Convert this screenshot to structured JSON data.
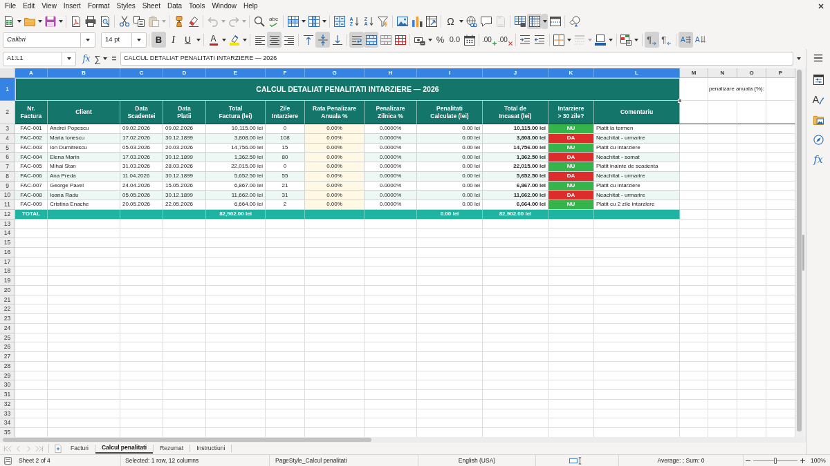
{
  "menu_bar": {
    "items": [
      "File",
      "Edit",
      "View",
      "Insert",
      "Format",
      "Styles",
      "Sheet",
      "Data",
      "Tools",
      "Window",
      "Help"
    ]
  },
  "standard_toolbar": [
    [
      {
        "kind": "new_document",
        "dropdown": true,
        "pressed": false,
        "disabled": false
      },
      {
        "kind": "open",
        "dropdown": true,
        "pressed": false,
        "disabled": false
      },
      {
        "kind": "save",
        "dropdown": true,
        "pressed": false,
        "disabled": false
      }
    ],
    [
      {
        "kind": "export_pdf",
        "dropdown": false,
        "pressed": false,
        "disabled": false
      },
      {
        "kind": "print",
        "dropdown": false,
        "pressed": false,
        "disabled": false
      },
      {
        "kind": "print_preview",
        "dropdown": false,
        "pressed": false,
        "disabled": false
      }
    ],
    [
      {
        "kind": "cut",
        "dropdown": false,
        "pressed": false,
        "disabled": false
      },
      {
        "kind": "copy",
        "dropdown": false,
        "pressed": false,
        "disabled": false
      },
      {
        "kind": "paste",
        "dropdown": true,
        "pressed": false,
        "disabled": true
      }
    ],
    [
      {
        "kind": "clone_formatting",
        "dropdown": false,
        "pressed": false,
        "disabled": false
      },
      {
        "kind": "clear_formatting",
        "dropdown": false,
        "pressed": false,
        "disabled": false
      }
    ],
    [
      {
        "kind": "undo",
        "dropdown": true,
        "pressed": false,
        "disabled": true
      },
      {
        "kind": "redo",
        "dropdown": true,
        "pressed": false,
        "disabled": true
      }
    ],
    [
      {
        "kind": "find_replace",
        "dropdown": false,
        "pressed": false,
        "disabled": false
      },
      {
        "kind": "spelling",
        "glyph": "abc",
        "dropdown": false,
        "pressed": false,
        "disabled": false
      }
    ],
    [
      {
        "kind": "row",
        "dropdown": true,
        "pressed": false,
        "disabled": false
      },
      {
        "kind": "column",
        "dropdown": true,
        "pressed": false,
        "disabled": false
      }
    ],
    [
      {
        "kind": "sort",
        "dropdown": false,
        "pressed": false,
        "disabled": false
      },
      {
        "kind": "sort_ascending",
        "glyph": "AZ",
        "dropdown": false,
        "pressed": false,
        "disabled": false
      },
      {
        "kind": "sort_descending",
        "glyph": "ZA",
        "dropdown": false,
        "pressed": false,
        "disabled": false
      },
      {
        "kind": "autofilter",
        "dropdown": false,
        "pressed": false,
        "disabled": false
      }
    ],
    [
      {
        "kind": "image",
        "dropdown": false,
        "pressed": false,
        "disabled": false
      },
      {
        "kind": "chart",
        "dropdown": false,
        "pressed": false,
        "disabled": false
      },
      {
        "kind": "pivot_table",
        "dropdown": false,
        "pressed": false,
        "disabled": false
      }
    ],
    [
      {
        "kind": "special_character",
        "glyph": "Ω",
        "dropdown": true,
        "pressed": false,
        "disabled": false
      },
      {
        "kind": "hyperlink",
        "dropdown": false,
        "pressed": false,
        "disabled": false
      },
      {
        "kind": "comment",
        "dropdown": false,
        "pressed": false,
        "disabled": false
      },
      {
        "kind": "header_footer",
        "dropdown": false,
        "pressed": false,
        "disabled": true
      }
    ],
    [
      {
        "kind": "print_area",
        "dropdown": false,
        "pressed": false,
        "disabled": false
      },
      {
        "kind": "freeze",
        "dropdown": true,
        "pressed": true,
        "disabled": false
      },
      {
        "kind": "split_window",
        "dropdown": false,
        "pressed": false,
        "disabled": false
      }
    ],
    [
      {
        "kind": "draw_functions",
        "dropdown": false,
        "pressed": false,
        "disabled": false
      }
    ]
  ],
  "formatting_toolbar": {
    "font_name": "Calibri",
    "font_size": "14 pt",
    "groups": [
      [
        {
          "kind": "bold",
          "glyph": "B",
          "dropdown": false,
          "pressed": true,
          "disabled": false
        },
        {
          "kind": "italic",
          "glyph": "I",
          "dropdown": false,
          "pressed": false,
          "disabled": false
        },
        {
          "kind": "underline",
          "glyph": "U",
          "dropdown": true,
          "pressed": false,
          "disabled": false
        }
      ],
      [
        {
          "kind": "font_color",
          "glyph": "A",
          "dropdown": true,
          "pressed": false,
          "disabled": false
        },
        {
          "kind": "highlight",
          "dropdown": true,
          "pressed": false,
          "disabled": false
        }
      ],
      [
        {
          "kind": "align_left",
          "dropdown": false,
          "pressed": false,
          "disabled": false
        },
        {
          "kind": "align_center",
          "dropdown": false,
          "pressed": true,
          "disabled": false
        },
        {
          "kind": "align_right",
          "dropdown": false,
          "pressed": false,
          "disabled": false
        }
      ],
      [
        {
          "kind": "align_top",
          "dropdown": false,
          "pressed": false,
          "disabled": false
        },
        {
          "kind": "align_middle",
          "dropdown": false,
          "pressed": true,
          "disabled": false
        },
        {
          "kind": "align_bottom",
          "dropdown": false,
          "pressed": false,
          "disabled": false
        }
      ],
      [
        {
          "kind": "wrap_text",
          "dropdown": false,
          "pressed": true,
          "disabled": false
        },
        {
          "kind": "merge_center",
          "dropdown": false,
          "pressed": true,
          "disabled": false
        },
        {
          "kind": "merge",
          "dropdown": false,
          "pressed": false,
          "disabled": false
        },
        {
          "kind": "unmerge",
          "dropdown": false,
          "pressed": false,
          "disabled": false
        }
      ],
      [
        {
          "kind": "currency",
          "dropdown": true,
          "pressed": false,
          "disabled": false
        },
        {
          "kind": "percent",
          "glyph": "%",
          "dropdown": false,
          "pressed": false,
          "disabled": false
        },
        {
          "kind": "number",
          "glyph": "0.0",
          "dropdown": false,
          "pressed": false,
          "disabled": false
        },
        {
          "kind": "date",
          "dropdown": false,
          "pressed": false,
          "disabled": false
        }
      ],
      [
        {
          "kind": "add_decimal",
          "glyph": ".00",
          "dropdown": false,
          "pressed": false,
          "disabled": false
        },
        {
          "kind": "delete_decimal",
          "glyph": ".00",
          "dropdown": false,
          "pressed": false,
          "disabled": false
        }
      ],
      [
        {
          "kind": "indent_increase",
          "dropdown": false,
          "pressed": false,
          "disabled": false
        },
        {
          "kind": "indent_decrease",
          "dropdown": false,
          "pressed": false,
          "disabled": false
        }
      ],
      [
        {
          "kind": "borders",
          "dropdown": true,
          "pressed": false,
          "disabled": false
        },
        {
          "kind": "border_style",
          "dropdown": true,
          "pressed": false,
          "disabled": true
        },
        {
          "kind": "border_color",
          "dropdown": true,
          "pressed": false,
          "disabled": false
        }
      ],
      [
        {
          "kind": "conditional",
          "dropdown": true,
          "pressed": false,
          "disabled": false
        }
      ],
      [
        {
          "kind": "ltr",
          "glyph": "¶",
          "dropdown": false,
          "pressed": true,
          "disabled": false
        },
        {
          "kind": "rtl",
          "glyph": "¶",
          "dropdown": false,
          "pressed": false,
          "disabled": false
        }
      ],
      [
        {
          "kind": "text_lr",
          "glyph": "A",
          "dropdown": false,
          "pressed": true,
          "disabled": false
        },
        {
          "kind": "text_tb",
          "glyph": "A",
          "dropdown": false,
          "pressed": false,
          "disabled": false
        }
      ]
    ]
  },
  "formula_bar": {
    "name_box": "A1:L1",
    "buttons": [
      {
        "kind": "function_wizard",
        "glyph": "fx",
        "dropdown": false
      },
      {
        "kind": "sum",
        "glyph": "∑",
        "dropdown": true
      },
      {
        "kind": "formula",
        "glyph": "=",
        "dropdown": false
      }
    ],
    "content": "CALCUL DETALIAT PENALITATI INTARZIERE — 2026"
  },
  "sidebar": [
    {
      "kind": "menu"
    },
    {
      "kind": "properties"
    },
    {
      "kind": "styles",
      "glyph": "A"
    },
    {
      "kind": "gallery"
    },
    {
      "kind": "navigator"
    },
    {
      "kind": "functions",
      "glyph": "fx"
    }
  ],
  "sheet": {
    "columns": [
      {
        "label": "A",
        "selected": true
      },
      {
        "label": "B",
        "selected": true
      },
      {
        "label": "C",
        "selected": true
      },
      {
        "label": "D",
        "selected": true
      },
      {
        "label": "E",
        "selected": true
      },
      {
        "label": "F",
        "selected": true
      },
      {
        "label": "G",
        "selected": true
      },
      {
        "label": "H",
        "selected": true
      },
      {
        "label": "I",
        "selected": true
      },
      {
        "label": "J",
        "selected": true
      },
      {
        "label": "K",
        "selected": true
      },
      {
        "label": "L",
        "selected": true
      },
      {
        "label": "M",
        "selected": false
      },
      {
        "label": "N",
        "selected": false
      },
      {
        "label": "O",
        "selected": false
      },
      {
        "label": "P",
        "selected": false
      }
    ],
    "rows": [
      {
        "label": "1",
        "selected": true
      },
      {
        "label": "2",
        "selected": false
      },
      {
        "label": "3",
        "selected": false
      },
      {
        "label": "4",
        "selected": false
      },
      {
        "label": "5",
        "selected": false
      },
      {
        "label": "6",
        "selected": false
      },
      {
        "label": "7",
        "selected": false
      },
      {
        "label": "8",
        "selected": false
      },
      {
        "label": "9",
        "selected": false
      },
      {
        "label": "10",
        "selected": false
      },
      {
        "label": "11",
        "selected": false
      },
      {
        "label": "12",
        "selected": false
      },
      {
        "label": "13",
        "selected": false
      },
      {
        "label": "14",
        "selected": false
      },
      {
        "label": "15",
        "selected": false
      },
      {
        "label": "16",
        "selected": false
      },
      {
        "label": "17",
        "selected": false
      },
      {
        "label": "18",
        "selected": false
      },
      {
        "label": "19",
        "selected": false
      },
      {
        "label": "20",
        "selected": false
      },
      {
        "label": "21",
        "selected": false
      },
      {
        "label": "22",
        "selected": false
      },
      {
        "label": "23",
        "selected": false
      },
      {
        "label": "24",
        "selected": false
      },
      {
        "label": "25",
        "selected": false
      },
      {
        "label": "26",
        "selected": false
      },
      {
        "label": "27",
        "selected": false
      },
      {
        "label": "28",
        "selected": false
      },
      {
        "label": "29",
        "selected": false
      },
      {
        "label": "30",
        "selected": false
      },
      {
        "label": "31",
        "selected": false
      },
      {
        "label": "32",
        "selected": false
      },
      {
        "label": "33",
        "selected": false
      },
      {
        "label": "34",
        "selected": false
      },
      {
        "label": "35",
        "selected": false
      }
    ],
    "title": "CALCUL DETALIAT PENALITATI INTARZIERE — 2026",
    "side_label": "penalizare anuala (%):",
    "headers": [
      "Nr.\nFactura",
      "Client",
      "Data\nScadentei",
      "Data\nPlatii",
      "Total\nFactura (lei)",
      "Zile\nIntarziere",
      "Rata Penalizare\nAnuala %",
      "Penalizare\nZilnica %",
      "Penalitati\nCalculate (lei)",
      "Total de\nIncasat (lei)",
      "Intarziere\n> 30 zile?",
      "Comentariu"
    ],
    "records": [
      {
        "invoice": "FAC-001",
        "client": "Andrei Popescu",
        "due_date": "09.02.2026",
        "payment_date": "09.02.2026",
        "invoice_total": "10,115.00 lei",
        "days_late": "0",
        "annual_rate": "0.00%",
        "daily_rate": "0.0000%",
        "penalties": "0.00 lei",
        "total_due": "10,115.00 lei",
        "over_30_days": {
          "text": "NU",
          "color": "#34b44a"
        },
        "comment": "Platit la termen"
      },
      {
        "invoice": "FAC-002",
        "client": "Maria Ionescu",
        "due_date": "17.02.2026",
        "payment_date": "30.12.1899",
        "invoice_total": "3,808.00 lei",
        "days_late": "108",
        "annual_rate": "0.00%",
        "daily_rate": "0.0000%",
        "penalties": "0.00 lei",
        "total_due": "3,808.00 lei",
        "over_30_days": {
          "text": "DA",
          "color": "#dd2c2c"
        },
        "comment": "Neachitat - urmarire"
      },
      {
        "invoice": "FAC-003",
        "client": "Ion Dumitrescu",
        "due_date": "05.03.2026",
        "payment_date": "20.03.2026",
        "invoice_total": "14,756.00 lei",
        "days_late": "15",
        "annual_rate": "0.00%",
        "daily_rate": "0.0000%",
        "penalties": "0.00 lei",
        "total_due": "14,756.00 lei",
        "over_30_days": {
          "text": "NU",
          "color": "#34b44a"
        },
        "comment": "Platit cu intarziere"
      },
      {
        "invoice": "FAC-004",
        "client": "Elena Marin",
        "due_date": "17.03.2026",
        "payment_date": "30.12.1899",
        "invoice_total": "1,362.50 lei",
        "days_late": "80",
        "annual_rate": "0.00%",
        "daily_rate": "0.0000%",
        "penalties": "0.00 lei",
        "total_due": "1,362.50 lei",
        "over_30_days": {
          "text": "DA",
          "color": "#dd2c2c"
        },
        "comment": "Neachitat - somat"
      },
      {
        "invoice": "FAC-005",
        "client": "Mihai Stan",
        "due_date": "31.03.2026",
        "payment_date": "28.03.2026",
        "invoice_total": "22,015.00 lei",
        "days_late": "0",
        "annual_rate": "0.00%",
        "daily_rate": "0.0000%",
        "penalties": "0.00 lei",
        "total_due": "22,015.00 lei",
        "over_30_days": {
          "text": "NU",
          "color": "#34b44a"
        },
        "comment": "Platit inainte de scadenta"
      },
      {
        "invoice": "FAC-006",
        "client": "Ana Preda",
        "due_date": "11.04.2026",
        "payment_date": "30.12.1899",
        "invoice_total": "5,652.50 lei",
        "days_late": "55",
        "annual_rate": "0.00%",
        "daily_rate": "0.0000%",
        "penalties": "0.00 lei",
        "total_due": "5,652.50 lei",
        "over_30_days": {
          "text": "DA",
          "color": "#dd2c2c"
        },
        "comment": "Neachitat - urmarire"
      },
      {
        "invoice": "FAC-007",
        "client": "George Pavel",
        "due_date": "24.04.2026",
        "payment_date": "15.05.2026",
        "invoice_total": "6,867.00 lei",
        "days_late": "21",
        "annual_rate": "0.00%",
        "daily_rate": "0.0000%",
        "penalties": "0.00 lei",
        "total_due": "6,867.00 lei",
        "over_30_days": {
          "text": "NU",
          "color": "#34b44a"
        },
        "comment": "Platit cu intarziere"
      },
      {
        "invoice": "FAC-008",
        "client": "Ioana Radu",
        "due_date": "05.05.2026",
        "payment_date": "30.12.1899",
        "invoice_total": "11,662.00 lei",
        "days_late": "31",
        "annual_rate": "0.00%",
        "daily_rate": "0.0000%",
        "penalties": "0.00 lei",
        "total_due": "11,662.00 lei",
        "over_30_days": {
          "text": "DA",
          "color": "#dd2c2c"
        },
        "comment": "Neachitat - urmarire"
      },
      {
        "invoice": "FAC-009",
        "client": "Cristina Enache",
        "due_date": "20.05.2026",
        "payment_date": "22.05.2026",
        "invoice_total": "6,664.00 lei",
        "days_late": "2",
        "annual_rate": "0.00%",
        "daily_rate": "0.0000%",
        "penalties": "0.00 lei",
        "total_due": "6,664.00 lei",
        "over_30_days": {
          "text": "NU",
          "color": "#34b44a"
        },
        "comment": "Platit cu 2 zile intarziere"
      }
    ],
    "total_row": {
      "label": "TOTAL",
      "invoice_total": "82,902.00 lei",
      "penalties": "0.00 lei",
      "total_due": "82,902.00 lei"
    }
  },
  "sheet_navigation": [
    {
      "kind": "first",
      "disabled": true
    },
    {
      "kind": "previous",
      "disabled": true
    },
    {
      "kind": "next",
      "disabled": true
    },
    {
      "kind": "last",
      "disabled": true
    }
  ],
  "sheet_tabs": [
    {
      "label": "Facturi",
      "selected": false
    },
    {
      "label": "Calcul penalitati",
      "selected": true
    },
    {
      "label": "Rezumat",
      "selected": false
    },
    {
      "label": "Instructiuni",
      "selected": false
    }
  ],
  "status_bar": {
    "sheet": "Sheet 2 of 4",
    "selection": "Selected: 1 row, 12 columns",
    "page_style": "PageStyle_Calcul penalitati",
    "language": "English (USA)",
    "summary": "Average: ; Sum: 0",
    "zoom": {
      "level": 0.5,
      "reading": "100%"
    }
  }
}
